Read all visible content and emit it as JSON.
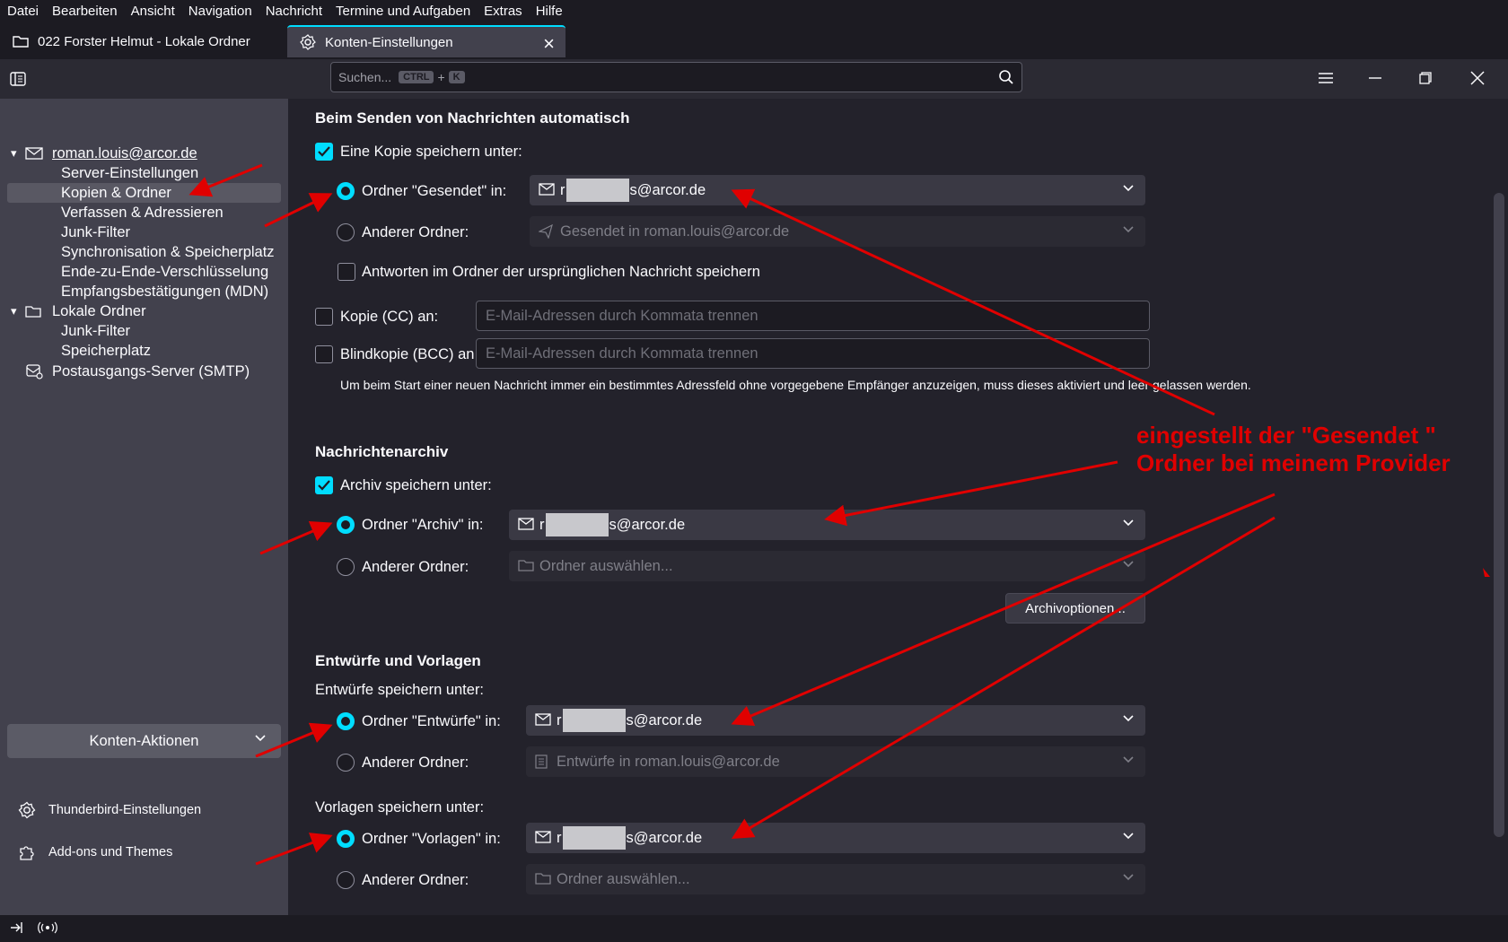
{
  "menubar": {
    "items": [
      "Datei",
      "Bearbeiten",
      "Ansicht",
      "Navigation",
      "Nachricht",
      "Termine und Aufgaben",
      "Extras",
      "Hilfe"
    ]
  },
  "tabs": [
    {
      "label": "022 Forster Helmut - Lokale Ordner",
      "icon": "folder-icon"
    },
    {
      "label": "Konten-Einstellungen",
      "icon": "settings-icon",
      "active": true
    }
  ],
  "search": {
    "placeholder": "Suchen...",
    "key1": "CTRL",
    "plus": "+",
    "key2": "K"
  },
  "sidebar": {
    "account": "roman.louis@arcor.de",
    "account_items": [
      "Server-Einstellungen",
      "Kopien & Ordner",
      "Verfassen & Adressieren",
      "Junk-Filter",
      "Synchronisation & Speicherplatz",
      "Ende-zu-Ende-Verschlüsselung",
      "Empfangsbestätigungen (MDN)"
    ],
    "local": "Lokale Ordner",
    "local_items": [
      "Junk-Filter",
      "Speicherplatz"
    ],
    "smtp": "Postausgangs-Server (SMTP)",
    "konten_aktionen": "Konten-Aktionen",
    "settings_link": "Thunderbird-Einstellungen",
    "addons_link": "Add-ons und Themes"
  },
  "main": {
    "sent_section": "Beim Senden von Nachrichten automatisch",
    "copy_label": "Eine Kopie speichern unter:",
    "sent_folder_label": "Ordner \"Gesendet\" in:",
    "sent_folder_value_prefix": "r",
    "sent_folder_value": "s@arcor.de",
    "other_folder_label": "Anderer Ordner:",
    "sent_other_value": "Gesendet in roman.louis@arcor.de",
    "reply_label": "Antworten im Ordner der ursprünglichen Nachricht speichern",
    "cc_label": "Kopie (CC) an:",
    "bcc_label": "Blindkopie (BCC) an:",
    "address_placeholder": "E-Mail-Adressen durch Kommata trennen",
    "note": "Um beim Start einer neuen Nachricht immer ein bestimmtes Adressfeld ohne vorgegebene Empfänger anzuzeigen, muss dieses aktiviert und leer gelassen werden.",
    "archive_section": "Nachrichtenarchiv",
    "archive_label": "Archiv speichern unter:",
    "archive_folder_label": "Ordner \"Archiv\" in:",
    "archive_folder_value_prefix": "r",
    "archive_folder_value": "s@arcor.de",
    "archive_other_value": "Ordner auswählen...",
    "archive_options": "Archivoptionen...",
    "drafts_section": "Entwürfe und Vorlagen",
    "drafts_save": "Entwürfe speichern unter:",
    "drafts_folder_label": "Ordner \"Entwürfe\" in:",
    "drafts_folder_value_prefix": "r",
    "drafts_folder_value": "s@arcor.de",
    "drafts_other_value": "Entwürfe in roman.louis@arcor.de",
    "templates_save": "Vorlagen speichern unter:",
    "templates_folder_label": "Ordner \"Vorlagen\" in:",
    "templates_folder_value_prefix": "r",
    "templates_folder_value": "s@arcor.de",
    "templates_other_value": "Ordner auswählen..."
  },
  "annotation": {
    "line1": "eingestellt der \"Gesendet \"",
    "line2": "Ordner bei meinem Provider",
    "color": "#e00000"
  },
  "colors": {
    "accent": "#00ddff",
    "sidebar_bg": "#42414d",
    "main_bg": "#23222b"
  }
}
